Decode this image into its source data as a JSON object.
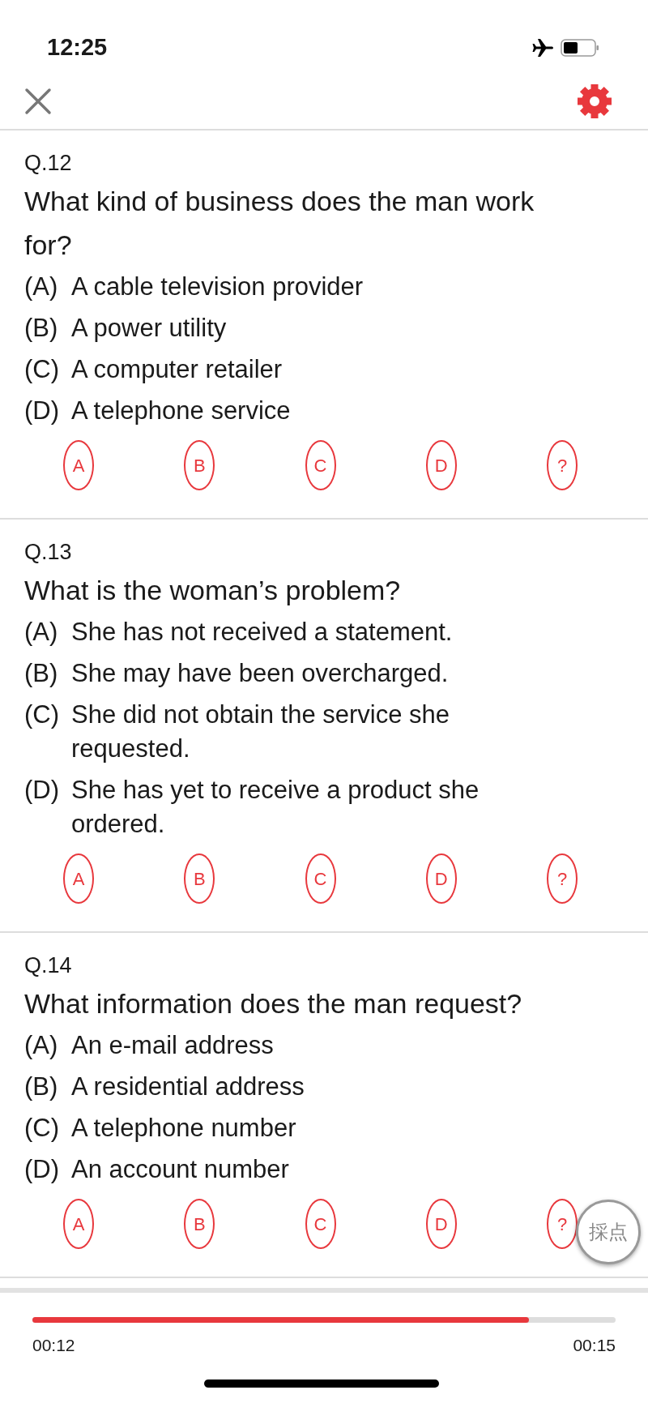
{
  "status_bar": {
    "time": "12:25"
  },
  "questions": [
    {
      "number": "Q.12",
      "text": "What kind of business does the man work for?",
      "options": [
        {
          "letter": "(A)",
          "text": "A cable television provider"
        },
        {
          "letter": "(B)",
          "text": "A power utility"
        },
        {
          "letter": "(C)",
          "text": "A computer retailer"
        },
        {
          "letter": "(D)",
          "text": "A telephone service"
        }
      ],
      "answers": [
        "A",
        "B",
        "C",
        "D",
        "?"
      ]
    },
    {
      "number": "Q.13",
      "text": "What is the woman’s problem?",
      "options": [
        {
          "letter": "(A)",
          "text": "She has not received a statement."
        },
        {
          "letter": "(B)",
          "text": "She may have been overcharged."
        },
        {
          "letter": "(C)",
          "text": "She did not obtain the service she requested."
        },
        {
          "letter": "(D)",
          "text": "She has yet to receive a product she ordered."
        }
      ],
      "answers": [
        "A",
        "B",
        "C",
        "D",
        "?"
      ]
    },
    {
      "number": "Q.14",
      "text": "What information does the man request?",
      "options": [
        {
          "letter": "(A)",
          "text": "An e-mail address"
        },
        {
          "letter": "(B)",
          "text": "A residential address"
        },
        {
          "letter": "(C)",
          "text": "A telephone number"
        },
        {
          "letter": "(D)",
          "text": "An account number"
        }
      ],
      "answers": [
        "A",
        "B",
        "C",
        "D",
        "?"
      ]
    }
  ],
  "score_button": {
    "label": "採点"
  },
  "player": {
    "level": 0.851,
    "elapsed": "00:12",
    "total": "00:15"
  }
}
